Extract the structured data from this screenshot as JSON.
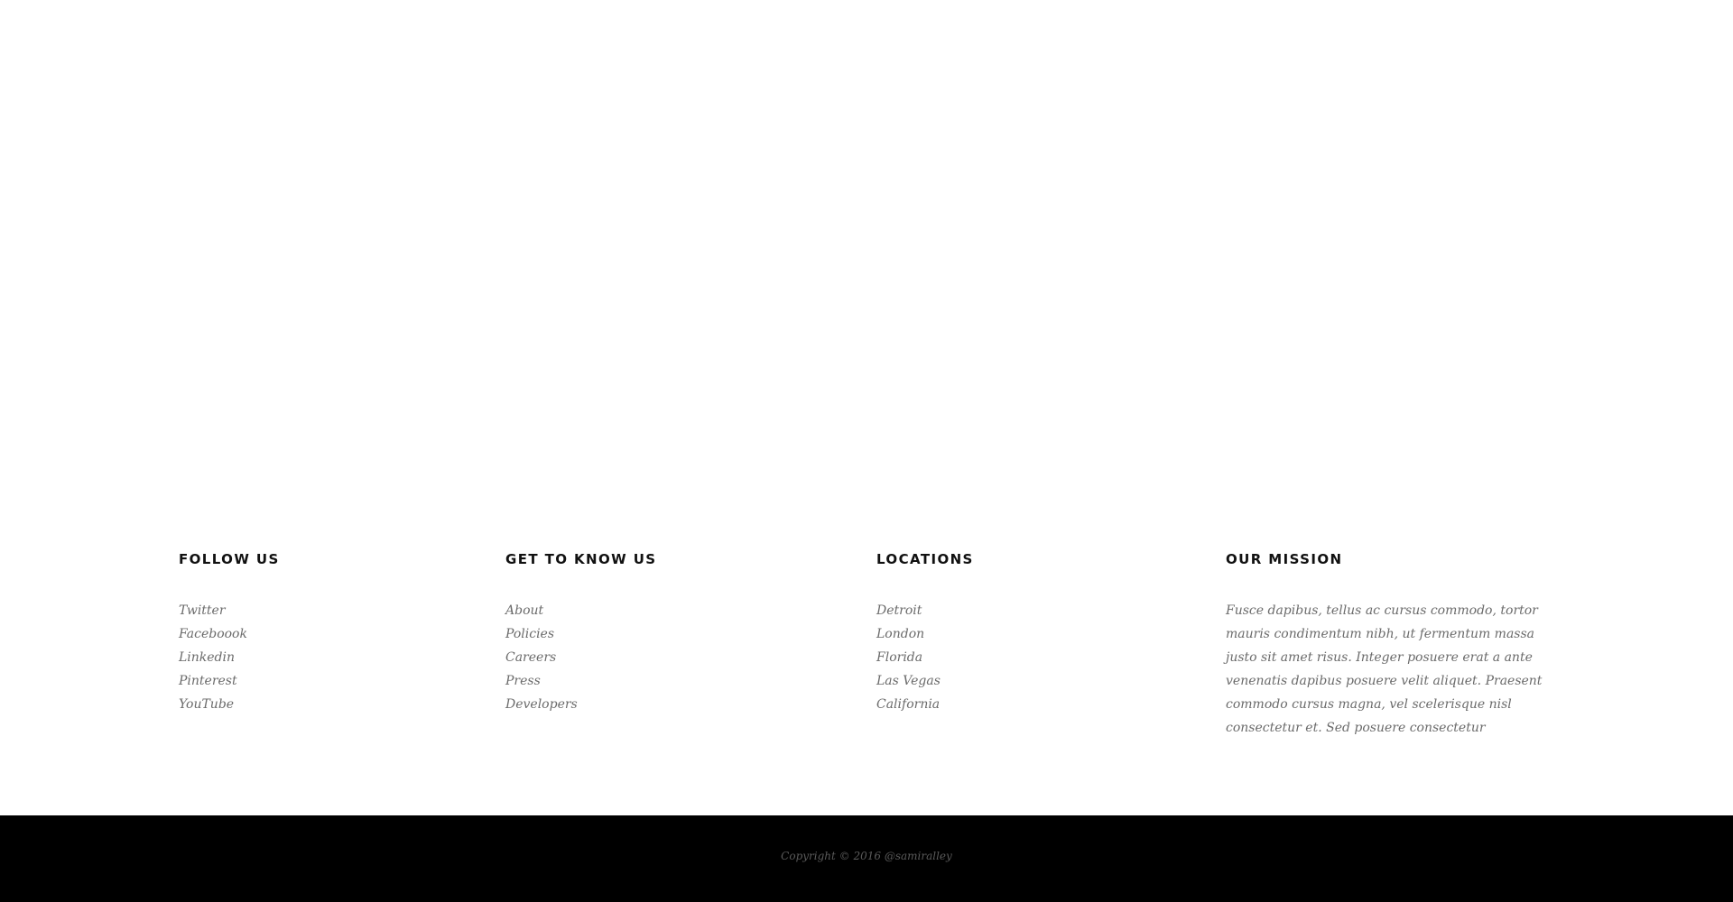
{
  "footer": {
    "follow": {
      "heading": "FOLLOW US",
      "links": [
        "Twitter",
        "Faceboook",
        "Linkedin",
        "Pinterest",
        "YouTube"
      ]
    },
    "know": {
      "heading": "GET TO KNOW US",
      "links": [
        "About",
        "Policies",
        "Careers",
        "Press",
        "Developers"
      ]
    },
    "locations": {
      "heading": "LOCATIONS",
      "links": [
        "Detroit",
        "London",
        "Florida",
        "Las Vegas",
        "California"
      ]
    },
    "mission": {
      "heading": "OUR MISSION",
      "text": "Fusce dapibus, tellus ac cursus commodo, tortor mauris condimentum nibh, ut fermentum massa justo sit amet risus. Integer posuere erat a ante venenatis dapibus posuere velit aliquet. Praesent commodo cursus magna, vel scelerisque nisl consectetur et. Sed posuere consectetur"
    }
  },
  "bottom_bar": {
    "copyright": "Copyright © 2016 @samiralley"
  },
  "colors": {
    "heading": "#111111",
    "link": "#6b6b6b",
    "bar_background": "#000000",
    "copyright": "#5a5a5a"
  }
}
